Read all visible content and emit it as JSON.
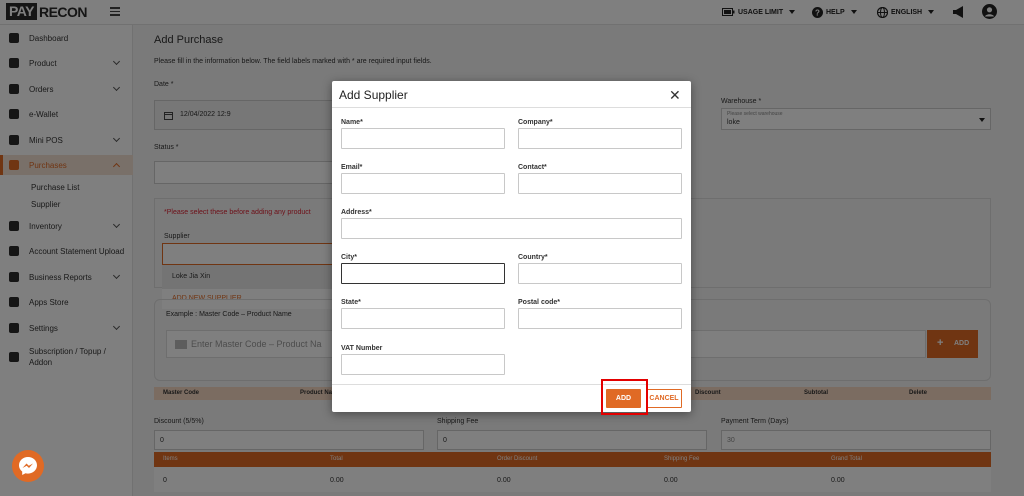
{
  "brand": {
    "part1": "PAY",
    "part2": "RECON"
  },
  "topnav": {
    "usage_limit": "USAGE LIMIT",
    "help": "HELP",
    "language": "ENGLISH"
  },
  "sidebar": {
    "items": [
      {
        "label": "Dashboard",
        "icon": "chart-line-icon"
      },
      {
        "label": "Product",
        "icon": "box-icon"
      },
      {
        "label": "Orders",
        "icon": "clipboard-icon"
      },
      {
        "label": "e-Wallet",
        "icon": "wallet-icon"
      },
      {
        "label": "Mini POS",
        "icon": "pos-icon"
      },
      {
        "label": "Purchases",
        "icon": "cart-icon"
      },
      {
        "label": "Inventory",
        "icon": "boxes-icon"
      },
      {
        "label": "Account Statement Upload",
        "icon": "upload-icon"
      },
      {
        "label": "Business Reports",
        "icon": "pie-chart-icon"
      },
      {
        "label": "Apps Store",
        "icon": "grid-icon"
      },
      {
        "label": "Settings",
        "icon": "gear-icon"
      },
      {
        "label": "Subscription / Topup /",
        "label2": "Addon",
        "icon": "dollar-icon"
      }
    ],
    "sub_items": [
      "Purchase List",
      "Supplier"
    ]
  },
  "page": {
    "title": "Add Purchase",
    "description": "Please fill in the information below. The field labels marked with * are required input fields.",
    "date_label": "Date *",
    "date_value": "12/04/2022 12:9",
    "warehouse_label": "Warehouse *",
    "warehouse_hint": "Please select warehouse",
    "warehouse_value": "loke",
    "status_label": "Status *",
    "notice": "*Please select these before adding any product",
    "supplier_label": "Supplier",
    "supplier_option": "Loke Jia Xin",
    "add_new_supplier": "ADD NEW SUPPLIER",
    "example_text": "Example : Master Code – Product Name",
    "product_placeholder": "Enter Master Code – Product Na",
    "add_button": "ADD",
    "table_headers": [
      "Master Code",
      "Product Na",
      "Discount",
      "Subtotal",
      "Delete"
    ],
    "discount_label": "Discount (5/5%)",
    "discount_value": "0",
    "shipping_label": "Shipping Fee",
    "shipping_value": "0",
    "payment_term_label": "Payment Term (Days)",
    "payment_term_value": "30",
    "summary_headers": [
      "Items",
      "Total",
      "Order Discount",
      "Shipping Fee",
      "Grand Total"
    ],
    "summary_values": [
      "0",
      "0.00",
      "0.00",
      "0.00",
      "0.00"
    ]
  },
  "modal": {
    "title": "Add Supplier",
    "close": "✕",
    "fields": {
      "name": "Name*",
      "company": "Company*",
      "email": "Email*",
      "contact": "Contact*",
      "address": "Address*",
      "city": "City*",
      "country": "Country*",
      "state": "State*",
      "postal_code": "Postal code*",
      "vat_number": "VAT Number"
    },
    "add_label": "ADD",
    "cancel_label": "CANCEL"
  },
  "colors": {
    "accent": "#e06a25",
    "highlight": "#e30000"
  }
}
